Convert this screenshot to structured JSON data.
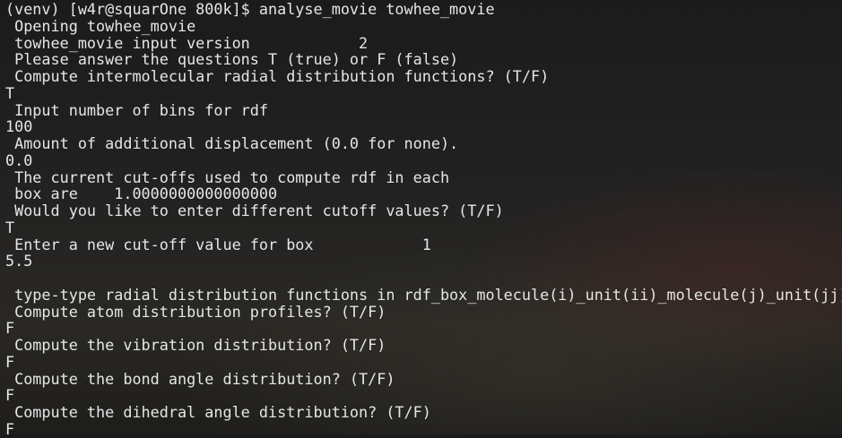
{
  "terminal": {
    "lines": [
      "(venv) [w4r@squarOne 800k]$ analyse_movie towhee_movie",
      " Opening towhee_movie",
      " towhee_movie input version            2",
      " Please answer the questions T (true) or F (false)",
      " Compute intermolecular radial distribution functions? (T/F)",
      "T",
      " Input number of bins for rdf",
      "100",
      " Amount of additional displacement (0.0 for none).",
      "0.0",
      " The current cut-offs used to compute rdf in each",
      " box are    1.0000000000000000",
      " Would you like to enter different cutoff values? (T/F)",
      "T",
      " Enter a new cut-off value for box            1",
      "5.5",
      "",
      " type-type radial distribution functions in rdf_box_molecule(i)_unit(ii)_molecule(j)_unit(jj)",
      " Compute atom distribution profiles? (T/F)",
      "F",
      " Compute the vibration distribution? (T/F)",
      "F",
      " Compute the bond angle distribution? (T/F)",
      "F",
      " Compute the dihedral angle distribution? (T/F)",
      "F"
    ]
  }
}
